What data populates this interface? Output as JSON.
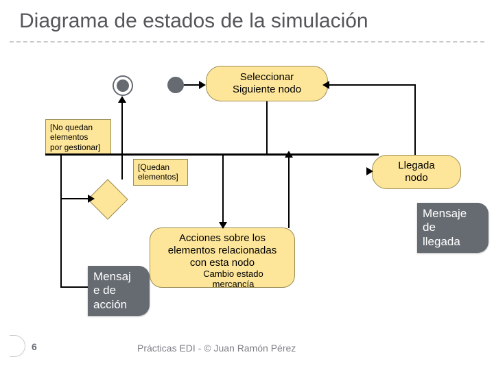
{
  "title": "Diagrama de estados de la simulación",
  "nodes": {
    "seleccionar_line1": "Seleccionar",
    "seleccionar_line2": "Siguiente nodo",
    "llegada_line1": "Llegada",
    "llegada_line2": "nodo",
    "acciones_line1": "Acciones sobre los",
    "acciones_line2": "elementos relacionadas",
    "acciones_line3": "con esta nodo",
    "cambio_line1": "Cambio estado",
    "cambio_line2": "mercancía"
  },
  "guards": {
    "no_quedan_line1": "[No quedan",
    "no_quedan_line2": "elementos",
    "no_quedan_line3": "por gestionar]",
    "quedan_line1": "[Quedan",
    "quedan_line2": "elementos]"
  },
  "labels": {
    "mensaje_llegada_line1": "Mensaje",
    "mensaje_llegada_line2": "de",
    "mensaje_llegada_line3": "llegada",
    "mensaje_accion_line1": "Mensaj",
    "mensaje_accion_line2": "e de",
    "mensaje_accion_line3": "acción"
  },
  "footer": {
    "page": "6",
    "credit": "Prácticas EDI - © Juan Ramón Pérez"
  }
}
